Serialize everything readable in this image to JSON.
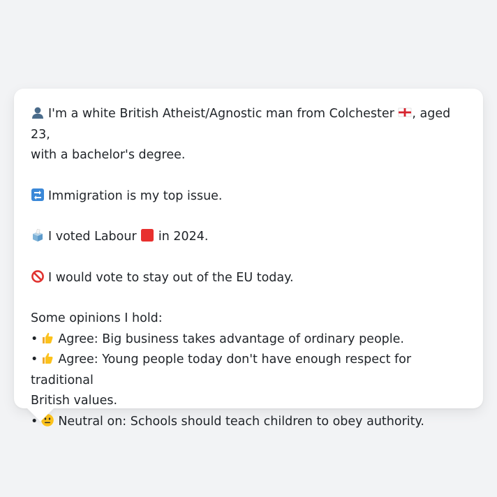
{
  "persona": {
    "intro_a": "I'm a white British Atheist/Agnostic man from Colchester",
    "intro_b": ", aged 23,",
    "intro_c": "with a bachelor's degree.",
    "issue": "Immigration is my top issue.",
    "vote_a": "I voted Labour",
    "vote_b": "in 2024.",
    "eu": "I would vote to stay out of the EU today.",
    "opinions_heading": "Some opinions I hold:",
    "bullet": "•",
    "opinions": [
      {
        "icon": "thumbs-up-icon",
        "text": "Agree: Big business takes advantage of ordinary people."
      },
      {
        "icon": "thumbs-up-icon",
        "text": "Agree: Young people today don't have enough respect for traditional"
      },
      {
        "icon": "",
        "text": "British values."
      },
      {
        "icon": "neutral-face-icon",
        "text": "Neutral on: Schools should teach children to obey authority."
      }
    ]
  },
  "colors": {
    "background": "#f2f3f5",
    "bubble": "#ffffff",
    "text": "#1f2328",
    "labour_red": "#e8302e",
    "arrows_blue": "#3b88d8"
  }
}
